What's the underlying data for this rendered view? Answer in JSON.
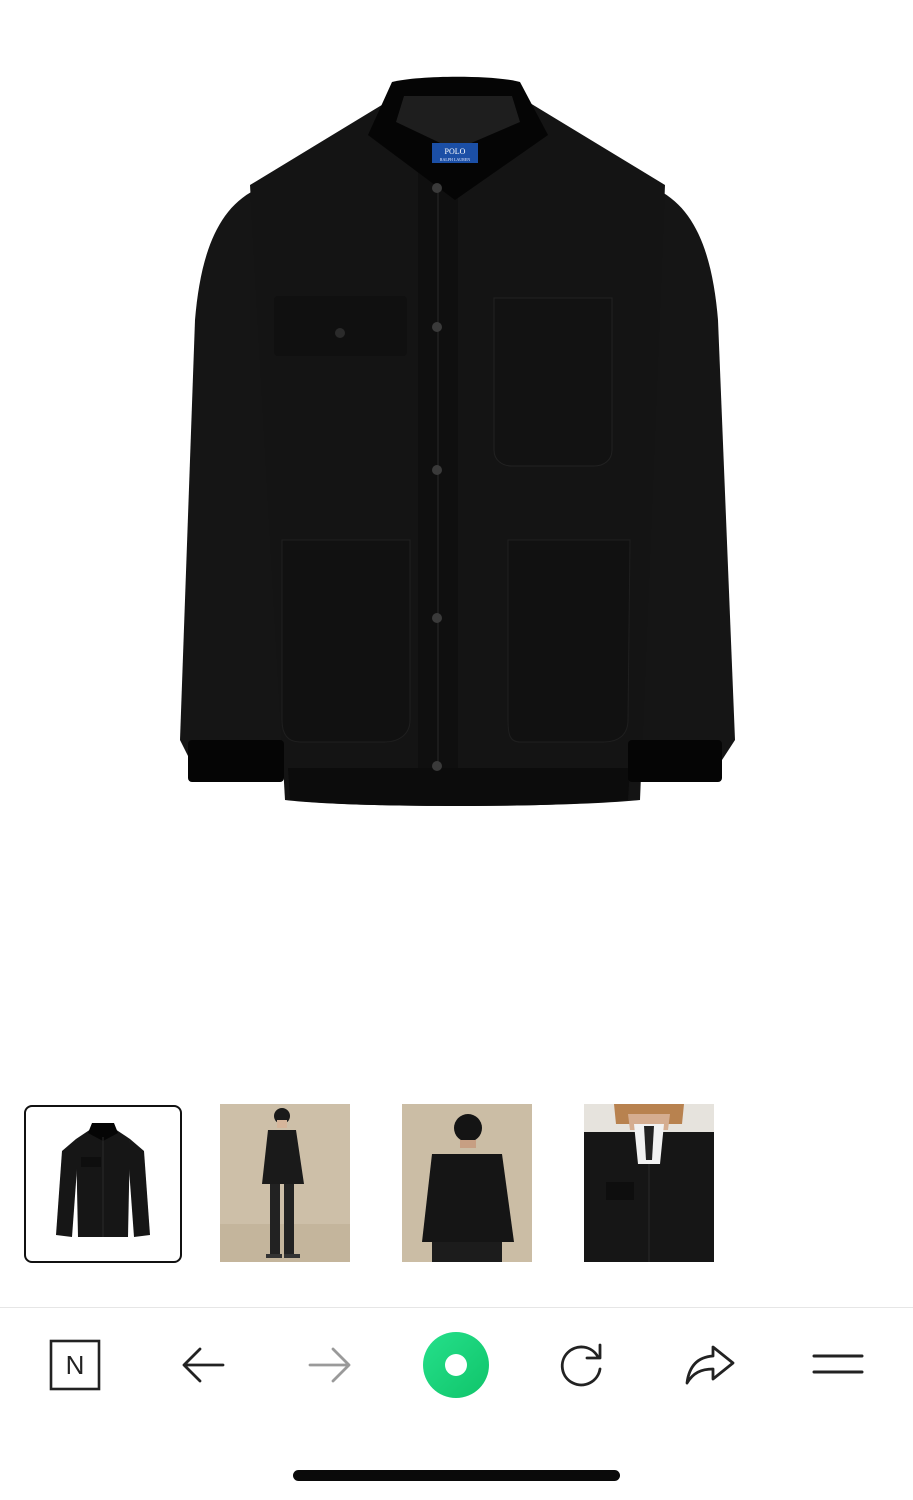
{
  "product": {
    "image_alt": "Black jacket with corduroy collar",
    "collar_label_line1": "POLO",
    "collar_label_line2": "RALPH LAUREN"
  },
  "gallery": {
    "thumbnails": [
      {
        "name": "thumb-product-front",
        "selected": true
      },
      {
        "name": "thumb-model-full",
        "selected": false
      },
      {
        "name": "thumb-model-back",
        "selected": false
      },
      {
        "name": "thumb-model-closeup",
        "selected": false
      }
    ]
  },
  "toolbar": {
    "items": [
      {
        "icon": "n-logo-icon",
        "glyph": "N"
      },
      {
        "icon": "back-arrow-icon"
      },
      {
        "icon": "forward-arrow-icon"
      },
      {
        "icon": "home-ring-icon"
      },
      {
        "icon": "reload-icon"
      },
      {
        "icon": "share-icon"
      },
      {
        "icon": "menu-icon"
      }
    ]
  },
  "colors": {
    "accent": "#1fd67c",
    "jacket": "#141414",
    "collar": "#050505",
    "label_blue": "#1b4fa6",
    "toolbar_icon": "#222222",
    "toolbar_icon_disabled": "#9a9a9a"
  }
}
